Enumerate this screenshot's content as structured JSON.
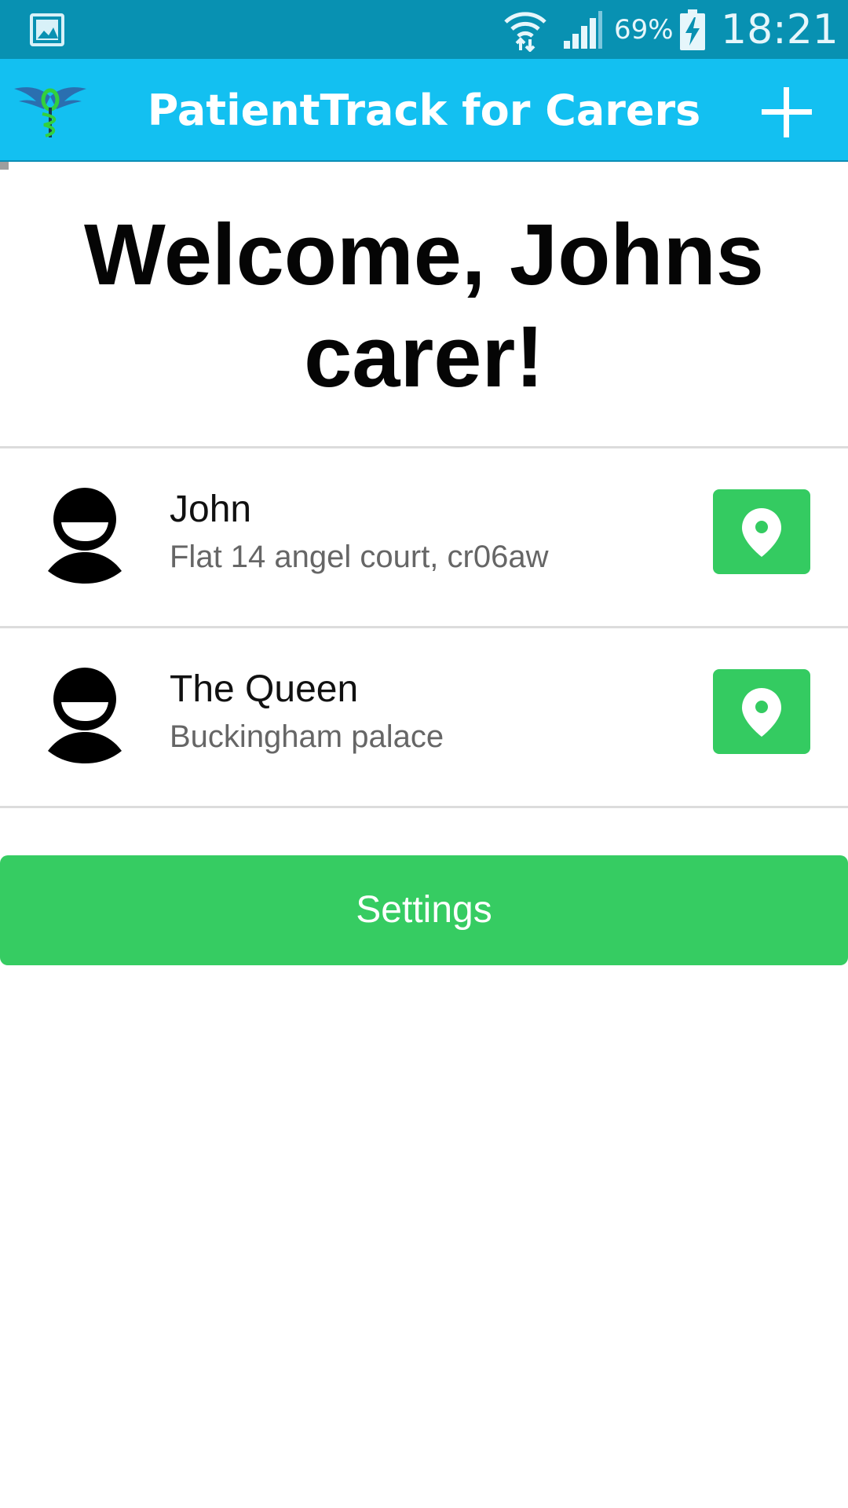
{
  "status_bar": {
    "battery_percent": "69%",
    "time": "18:21",
    "icons": [
      "gallery-notification-icon",
      "wifi-icon",
      "cell-signal-icon",
      "battery-charging-icon"
    ]
  },
  "app_bar": {
    "title": "PatientTrack for Carers",
    "logo_icon": "caduceus-logo-icon",
    "action_icon": "plus-icon"
  },
  "main": {
    "welcome_text": "Welcome, Johns carer!",
    "patients": [
      {
        "name": "John",
        "address": "Flat 14 angel court, cr06aw"
      },
      {
        "name": "The Queen",
        "address": "Buckingham palace"
      }
    ],
    "settings_label": "Settings"
  },
  "colors": {
    "status_bar": "#0891b2",
    "app_bar": "#13c0f1",
    "accent_green": "#34cb61",
    "divider": "#dcdcdc",
    "secondary_text": "#666666"
  }
}
